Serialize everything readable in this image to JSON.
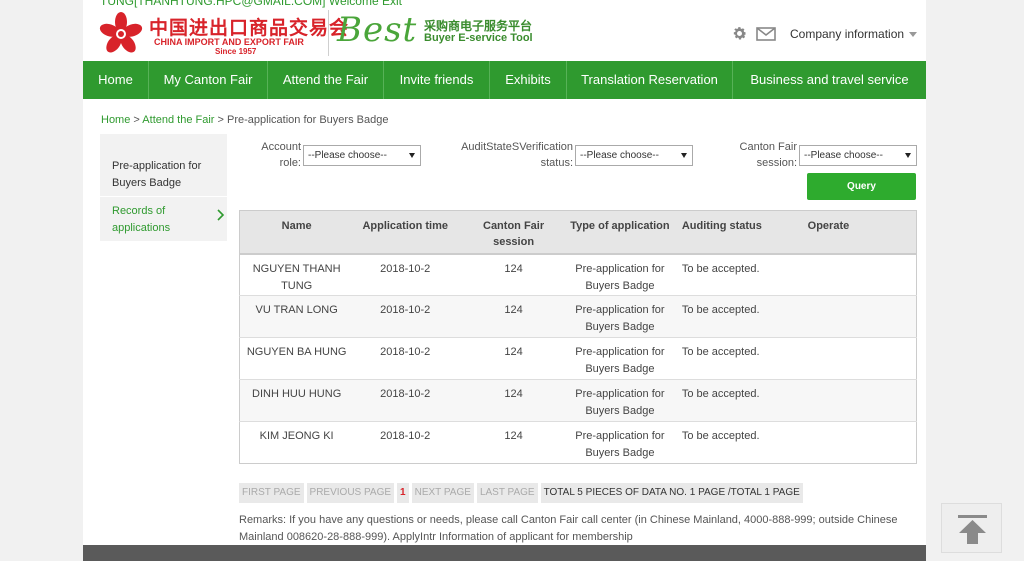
{
  "header": {
    "welcome": "TUNG[THANHTUNG.HPC@GMAIL.COM] Welcome Exit",
    "logo_cn": "中国进出口商品交易会",
    "logo_en": "CHINA IMPORT AND EXPORT FAIR",
    "logo_since": "Since 1957",
    "best_logo": "Best",
    "best_cn": "采购商电子服务平台",
    "best_en": "Buyer E-service Tool",
    "company_menu": "Company information"
  },
  "nav": [
    {
      "label": "Home"
    },
    {
      "label": "My Canton Fair"
    },
    {
      "label": "Attend the Fair"
    },
    {
      "label": "Invite friends"
    },
    {
      "label": "Exhibits"
    },
    {
      "label": "Translation Reservation"
    },
    {
      "label": "Business and travel service"
    }
  ],
  "breadcrumb": {
    "home": "Home",
    "sep": ">",
    "parent": "Attend the Fair",
    "current": "Pre-application for Buyers Badge"
  },
  "sidebar": {
    "items": [
      {
        "label": "Pre-application for Buyers Badge"
      },
      {
        "label": "Records of applications"
      }
    ]
  },
  "filters": {
    "account_role_label": "Account role:",
    "audit_label": "AuditStateSVerification status:",
    "session_label": "Canton Fair session:",
    "account_role_value": "--Please choose--",
    "audit_value": "--Please choose--",
    "session_value": "--Please choose--",
    "query_label": "Query"
  },
  "table": {
    "headers": [
      "Name",
      "Application time",
      "Canton Fair session",
      "Type of application",
      "Auditing status",
      "Operate"
    ],
    "rows": [
      [
        "NGUYEN THANH TUNG",
        "2018-10-2",
        "124",
        "Pre-application for Buyers Badge",
        "To be accepted.",
        ""
      ],
      [
        "VU TRAN LONG",
        "2018-10-2",
        "124",
        "Pre-application for Buyers Badge",
        "To be accepted.",
        ""
      ],
      [
        "NGUYEN BA HUNG",
        "2018-10-2",
        "124",
        "Pre-application for Buyers Badge",
        "To be accepted.",
        ""
      ],
      [
        "DINH HUU HUNG",
        "2018-10-2",
        "124",
        "Pre-application for Buyers Badge",
        "To be accepted.",
        ""
      ],
      [
        "KIM JEONG KI",
        "2018-10-2",
        "124",
        "Pre-application for Buyers Badge",
        "To be accepted.",
        ""
      ]
    ]
  },
  "pager": {
    "first": "FIRST PAGE",
    "prev": "PREVIOUS PAGE",
    "current": "1",
    "next": "NEXT PAGE",
    "last": "LAST PAGE",
    "summary": "TOTAL 5 PIECES OF DATA NO. 1 PAGE /TOTAL 1 PAGE"
  },
  "remarks": "Remarks: If you have any questions or needs, please call Canton Fair call center (in Chinese Mainland, 4000-888-999; outside Chinese Mainland 008620-28-888-999). ApplyIntr Information of applicant for membership",
  "colors": {
    "brand_green": "#2f9a2f",
    "logo_red": "#d8232a"
  },
  "icons": [
    "settings-gear-icon",
    "mail-icon",
    "chevron-right-icon",
    "back-to-top-icon",
    "canton-fair-flower-logo"
  ]
}
